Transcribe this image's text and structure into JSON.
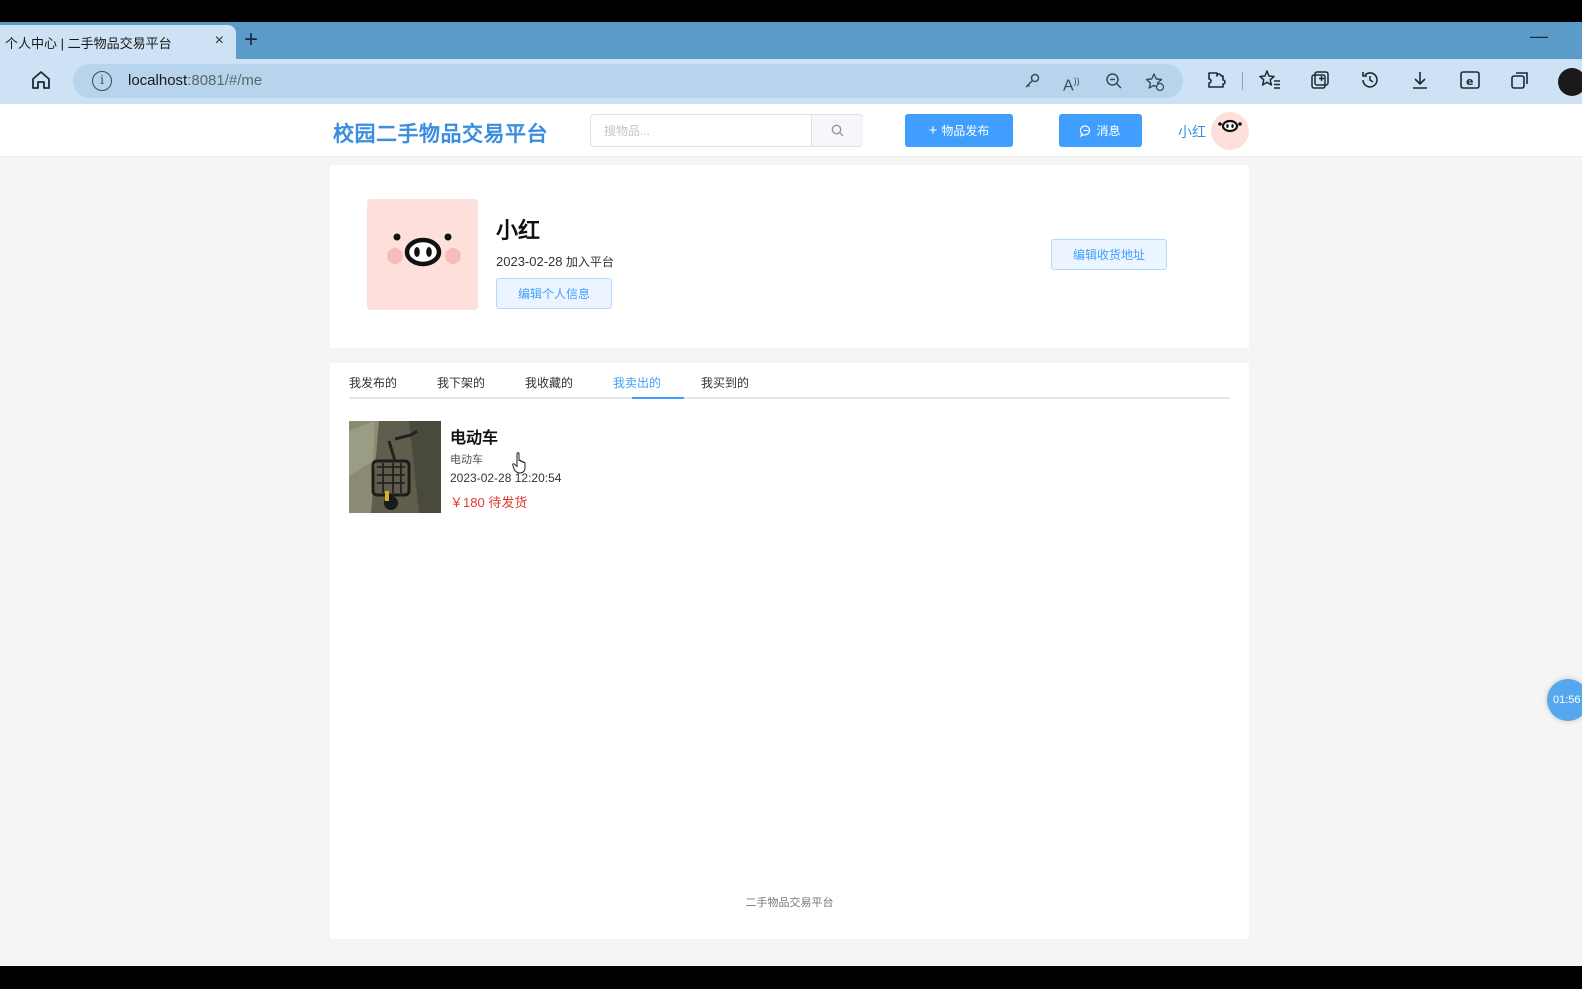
{
  "browser": {
    "tab_title": "个人中心 | 二手物品交易平台",
    "tab_close": "×",
    "new_tab": "+",
    "url_host": "localhost",
    "url_rest": ":8081/#/me"
  },
  "header": {
    "logo": "校园二手物品交易平台",
    "search_placeholder": "搜物品...",
    "publish_label": "物品发布",
    "message_label": "消息",
    "nickname": "小红"
  },
  "profile": {
    "name": "小红",
    "join_date": "2023-02-28",
    "join_suffix": "加入平台",
    "edit_info_label": "编辑个人信息",
    "edit_address_label": "编辑收货地址"
  },
  "tabs": [
    {
      "label": "我发布的"
    },
    {
      "label": "我下架的"
    },
    {
      "label": "我收藏的"
    },
    {
      "label": "我卖出的",
      "active": true
    },
    {
      "label": "我买到的"
    }
  ],
  "items": [
    {
      "title": "电动车",
      "description": "电动车",
      "time": "2023-02-28 12:20:54",
      "price": "￥180",
      "status": "待发货"
    }
  ],
  "footer": "二手物品交易平台",
  "timer": "01:56",
  "colors": {
    "brand": "#3b8de0",
    "primary": "#409eff",
    "price": "#e03b2a",
    "avatar_bg": "#fde0dc"
  }
}
